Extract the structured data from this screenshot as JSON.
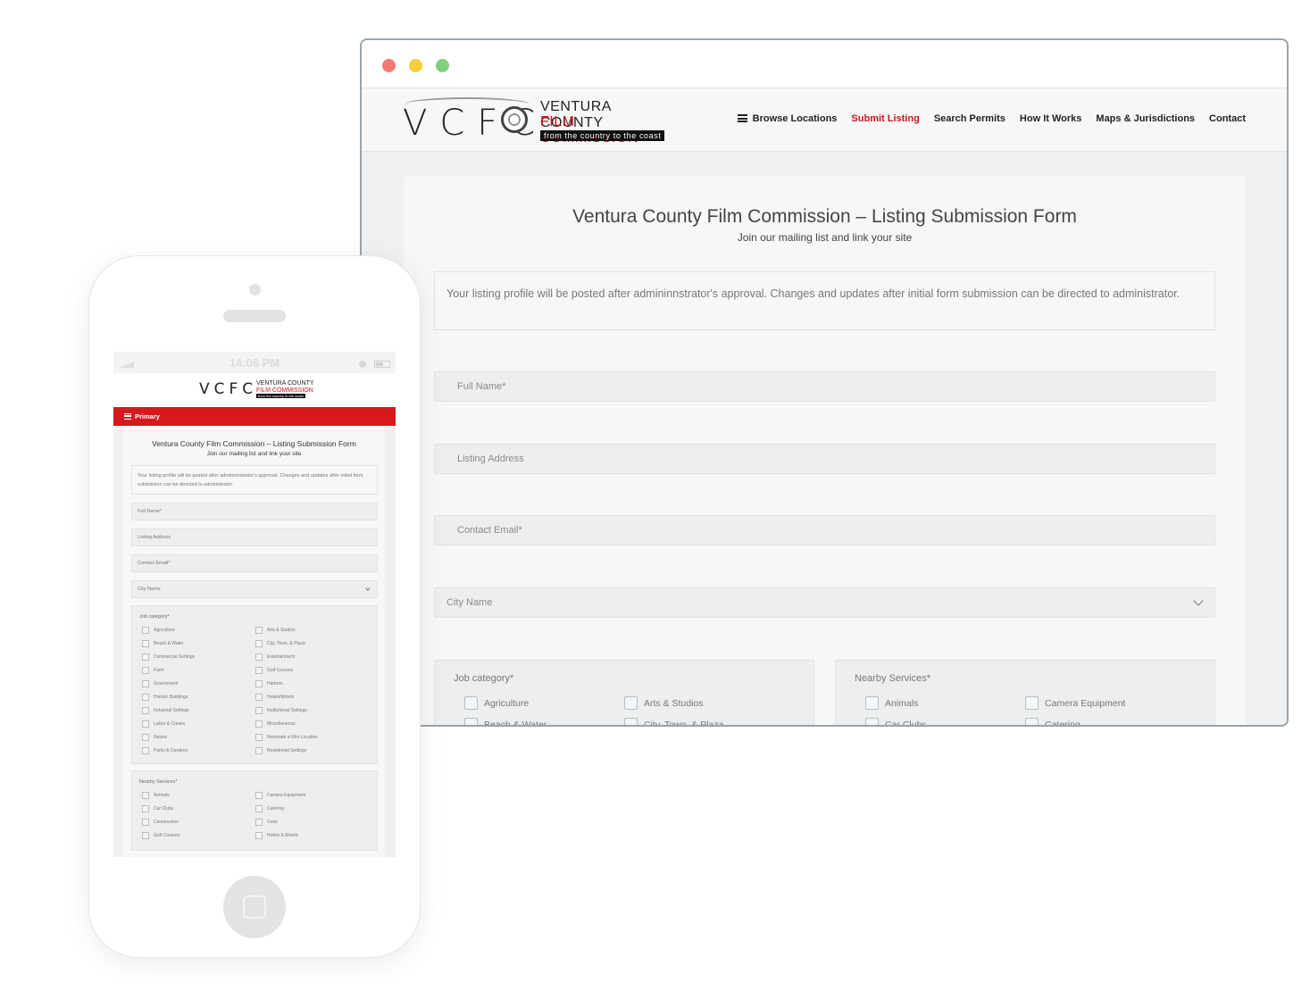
{
  "desktop": {
    "logo": {
      "mark": "VCFC",
      "line1": "VENTURA COUNTY",
      "line2": "FILM COMMISSION",
      "tagline": "from the country to the coast"
    },
    "nav": [
      "Browse Locations",
      "Submit Listing",
      "Search Permits",
      "How It Works",
      "Maps & Jurisdictions",
      "Contact"
    ],
    "active_nav": "Submit Listing",
    "form": {
      "title": "Ventura County Film Commission – Listing Submission Form",
      "subtitle": "Join our mailing list and link your site",
      "notice": "Your listing profile will be posted after admininnstrator's approval. Changes and updates after initial form submission can be directed to administrator.",
      "full_name": "Full Name*",
      "listing_address": "Listing Address",
      "contact_email": "Contact Email*",
      "city_name": "City Name",
      "job_category": {
        "label": "Job category*",
        "items": [
          "Agriculture",
          "Arts & Studios",
          "Beach & Water",
          "City, Town, & Plaza"
        ]
      },
      "nearby_services": {
        "label": "Nearby Services*",
        "items": [
          "Animals",
          "Camera Equipment",
          "Car Clubs",
          "Catering"
        ]
      }
    }
  },
  "mobile": {
    "time": "14:06 PM",
    "logo": {
      "mark": "VCFC",
      "line1": "VENTURA COUNTY",
      "line2": "FILM COMMISSION",
      "tagline": "from the country to the coast"
    },
    "menu_label": "Primary",
    "form": {
      "title": "Ventura County Film Commission – Listing Submission Form",
      "subtitle": "Join our mailing list and link your site",
      "notice": "Your listing profile will be posted after admininnstrator's approval. Changes and updates after initial form submission can be directed to administrator.",
      "full_name": "Full Name*",
      "listing_address": "Listing Address",
      "contact_email": "Contact Email*",
      "city_name": "City Name",
      "job_category": {
        "label": "Job category*",
        "left": [
          "Agriculture",
          "Beach & Water",
          "Commercial Settings",
          "Farm",
          "Government",
          "Historic Buildings",
          "Industrial Settings",
          "Lakes & Creeks",
          "Nature",
          "Parks & Gardens"
        ],
        "right": [
          "Arts & Studios",
          "City, Town, & Plaza",
          "Entertainment",
          "Golf Courses",
          "Harbors",
          "Hotels/Motels",
          "Institutional Settings",
          "Miscellaneous",
          "Nominate a Film Location",
          "Residential Settings"
        ]
      },
      "nearby_services": {
        "label": "Nearby Services*",
        "left": [
          "Animals",
          "Car Clubs",
          "Construction",
          "Golf Courses"
        ],
        "right": [
          "Camera Equipment",
          "Catering",
          "Crew",
          "Hotels & Motels"
        ]
      }
    }
  },
  "colors": {
    "brand_red": "#c8161d",
    "menu_red": "#d6191d"
  }
}
